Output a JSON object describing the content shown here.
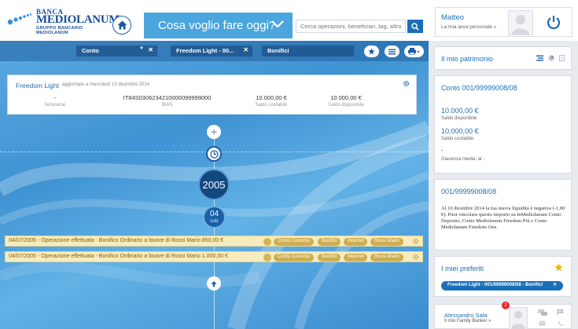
{
  "brand": {
    "line1": "BANCA",
    "line2": "MEDIOLANUM",
    "line3": "GRUPPO BANCARIO MEDIOLANUM",
    "colors": {
      "primary": "#1b4f9b",
      "accent": "#4aa6dc"
    }
  },
  "header": {
    "cosa_label": "Cosa voglio fare oggi?",
    "search_placeholder": "Cerca operazioni, beneficiari, tag, altro...",
    "user_name": "Matteo",
    "user_sub": "La mia area personale »"
  },
  "filters": {
    "conto": "Conto",
    "account": "Freedom Light - 00...",
    "bonifici": "Bonifici"
  },
  "account": {
    "title": "Freedom Light",
    "updated": "aggiornato a mercoledì 10 dicembre 2014",
    "cols": [
      {
        "value": "-",
        "label": "Nickname"
      },
      {
        "value": "IT84S0306234210000099999000",
        "label": "IBAN"
      },
      {
        "value": "10.000,00 €",
        "label": "Saldo contabile"
      },
      {
        "value": "10.000,00 €",
        "label": "Saldo disponibile"
      }
    ]
  },
  "timeline": {
    "year": "2005",
    "day": "04",
    "month": "LUG"
  },
  "operations": [
    {
      "text": "04/07/2005 - Operazione effettuata - Bonifico Ordinario a favore di Rossi Mario 850,00 €",
      "tags": [
        "Conto Corrente",
        "Bonifici",
        "Internet",
        "Rossi Mario"
      ]
    },
    {
      "text": "04/07/2005 - Operazione effettuata - Bonifico Ordinario a favore di Rossi Mario 1.000,00 €",
      "tags": [
        "Conto Corrente",
        "Bonifici",
        "Internet",
        "Rossi Mario"
      ]
    }
  ],
  "right": {
    "patrimonio_title": "Il mio patrimonio",
    "conto_title": "Conto 001/99999008/08",
    "saldo_disp_value": "10.000,00 €",
    "saldo_disp_label": "Saldo disponibile",
    "saldo_cont_value": "10.000,00 €",
    "saldo_cont_label": "Saldo contabile",
    "giacenza_value": "-",
    "giacenza_label": "Giacenza media: al -",
    "msg_title": "001/99999008/08",
    "msg_text": "Al 10 dicembre 2014 la tua nuova liquidità è negativa (-1,00 €). Puoi vincolare questo importo su InMediolanum Conto Deposito, Conto Mediolanum Freedom Più e Conto Mediolanum Freedom One.",
    "preferiti_title": "I miei preferiti",
    "preferiti_chip": "Freedom Light - 001/99999008/08 - Bonifici",
    "contact_name": "Alessandro Sala",
    "contact_sub": "Il mio Family Banker »",
    "contact_badge": "2"
  }
}
